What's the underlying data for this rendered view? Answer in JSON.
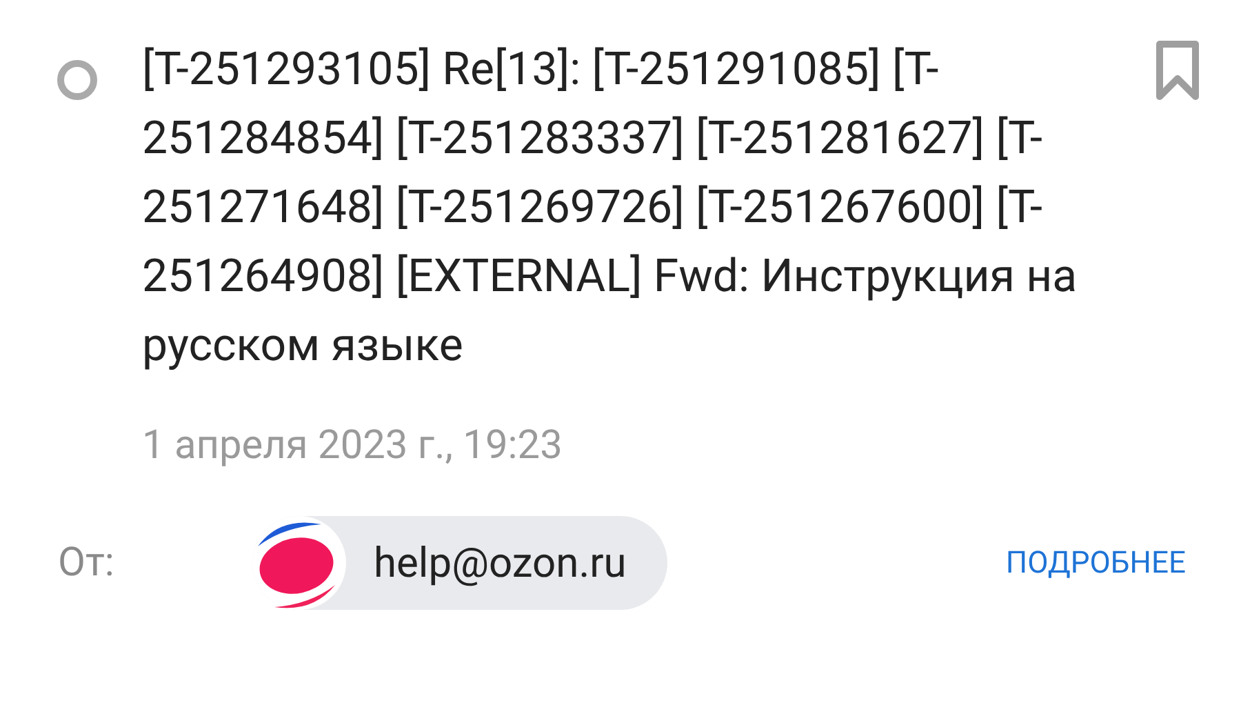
{
  "message": {
    "unread": false,
    "subject": "[T-251293105] Re[13]: [T-251291085] [T-251284854] [T-251283337] [T-251281627] [T-251271648] [T-251269726] [T-251267600] [T-251264908] [EXTERNAL] Fwd: Инструкция на русском языке",
    "bookmarked": false,
    "date": "1 апреля 2023 г., 19:23"
  },
  "sender": {
    "label": "От:",
    "address": "help@ozon.ru",
    "details_link": "ПОДРОБНЕЕ"
  }
}
